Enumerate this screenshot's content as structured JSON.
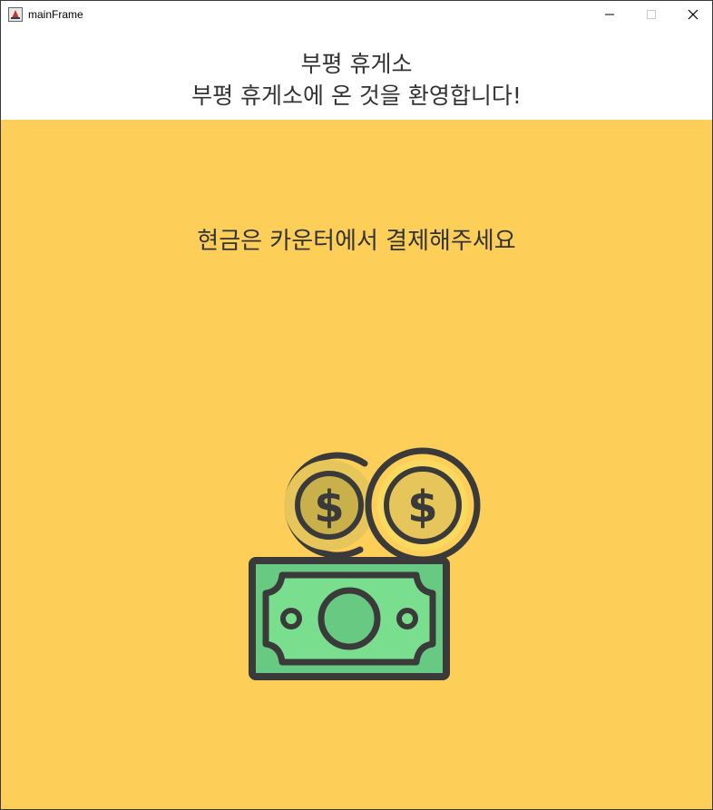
{
  "window": {
    "title": "mainFrame",
    "controls": {
      "minimize": "minimize-icon",
      "maximize": "maximize-icon",
      "close": "close-icon"
    }
  },
  "header": {
    "title": "부평 휴게소",
    "welcome": "부평 휴게소에 온 것을 환영합니다!"
  },
  "content": {
    "message": "현금은 카운터에서 결제해주세요",
    "illustration": "cash-money-icon"
  },
  "colors": {
    "background": "#fecf58",
    "bill_green": "#79df8e",
    "coin_yellow": "#e6c65a",
    "outline": "#3a3a3a"
  }
}
